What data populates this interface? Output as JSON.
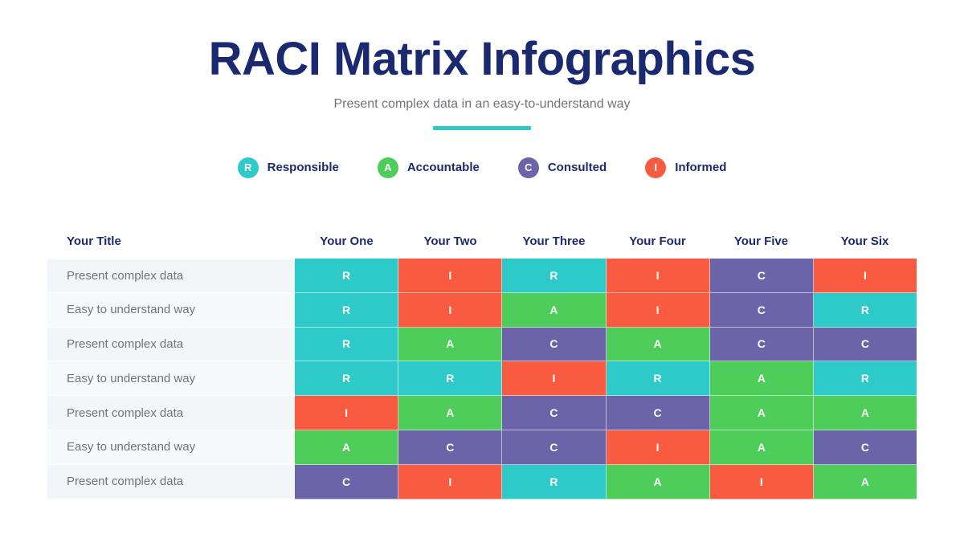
{
  "header": {
    "title": "RACI Matrix Infographics",
    "subtitle": "Present complex data in an easy-to-understand way"
  },
  "colors": {
    "title": "#1b2a70",
    "subtitle": "#6f7479",
    "accent": "#2ec9c9",
    "R": "#2ec9c9",
    "A": "#4ecd5b",
    "C": "#6b64a8",
    "I": "#f95b40",
    "row_label_bg": "#f2f6f8",
    "row_label_bg_alt": "#f7fafb"
  },
  "legend": [
    {
      "key": "R",
      "label": "Responsible",
      "color": "#2ec9c9"
    },
    {
      "key": "A",
      "label": "Accountable",
      "color": "#4ecd5b"
    },
    {
      "key": "C",
      "label": "Consulted",
      "color": "#6b64a8"
    },
    {
      "key": "I",
      "label": "Informed",
      "color": "#f95b40"
    }
  ],
  "table": {
    "row_header_label": "Your Title",
    "columns": [
      "Your One",
      "Your Two",
      "Your Three",
      "Your Four",
      "Your Five",
      "Your Six"
    ],
    "rows": [
      {
        "label": "Present complex data",
        "values": [
          "R",
          "I",
          "R",
          "I",
          "C",
          "I"
        ]
      },
      {
        "label": "Easy to understand way",
        "values": [
          "R",
          "I",
          "A",
          "I",
          "C",
          "R"
        ]
      },
      {
        "label": "Present complex data",
        "values": [
          "R",
          "A",
          "C",
          "A",
          "C",
          "C"
        ]
      },
      {
        "label": "Easy to understand way",
        "values": [
          "R",
          "R",
          "I",
          "R",
          "A",
          "R"
        ]
      },
      {
        "label": "Present complex data",
        "values": [
          "I",
          "A",
          "C",
          "C",
          "A",
          "A"
        ]
      },
      {
        "label": "Easy to understand way",
        "values": [
          "A",
          "C",
          "C",
          "I",
          "A",
          "C"
        ]
      },
      {
        "label": "Present complex data",
        "values": [
          "C",
          "I",
          "R",
          "A",
          "I",
          "A"
        ]
      }
    ]
  }
}
